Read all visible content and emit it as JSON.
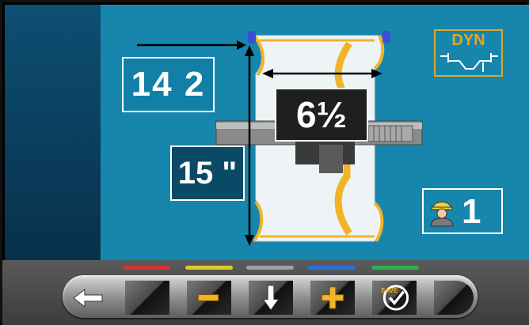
{
  "display": {
    "rim_offset_value": "14 2",
    "rim_diameter_value": "15 \"",
    "rim_width_value": "6½",
    "mode_label": "DYN",
    "operator_number": "1"
  },
  "toolbar": {
    "indicator_colors": [
      "#d9332b",
      "#d9cf2b",
      "#a0a0a0",
      "#2b6fd9",
      "#2bb34a"
    ],
    "save_text": "SAVE"
  },
  "colors": {
    "main_background": "#1786ac",
    "left_panel": "#0a3d5b",
    "accent_orange": "#e1a526",
    "rim_yellow": "#f1b32a"
  },
  "icons": [
    "back-arrow-icon",
    "minus-icon",
    "down-arrow-icon",
    "plus-icon",
    "save-check-icon",
    "operator-icon"
  ]
}
